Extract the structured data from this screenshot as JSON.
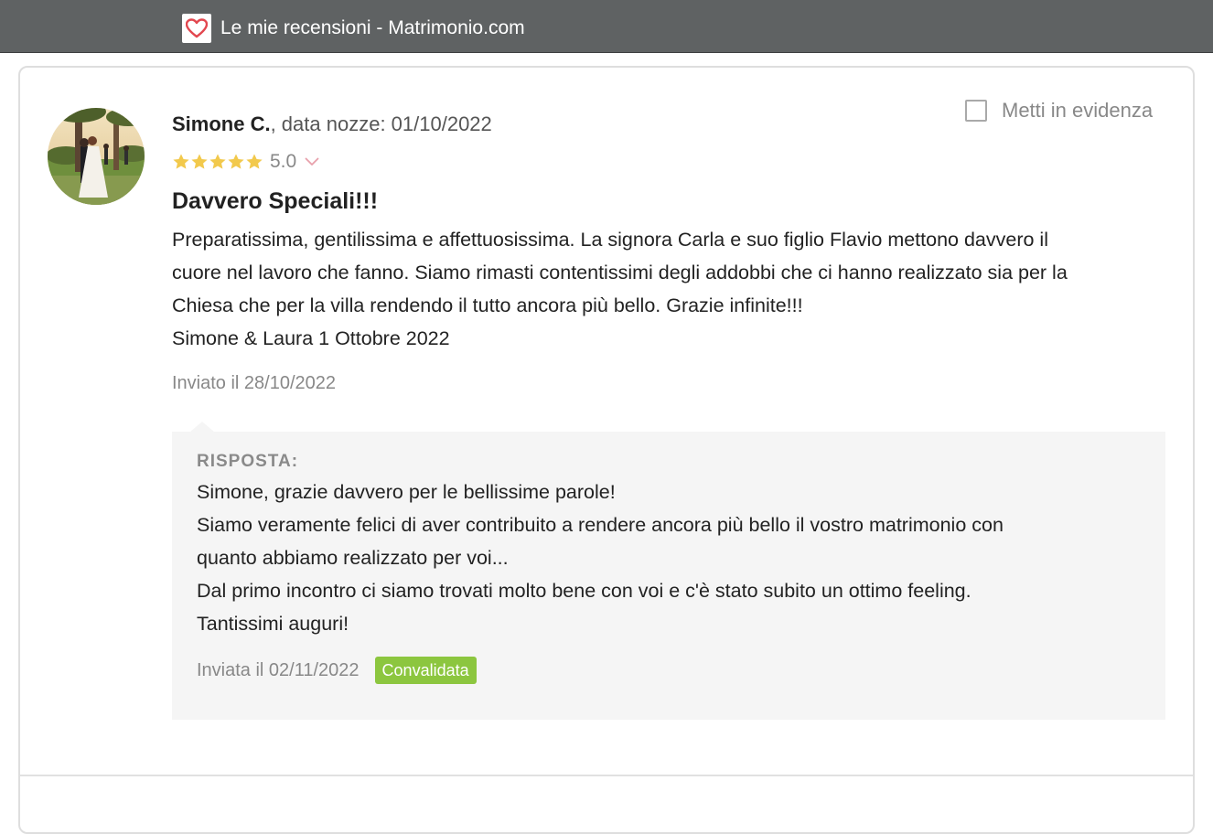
{
  "window": {
    "title": "Le mie recensioni - Matrimonio.com",
    "icon": "matrimonio-heart-icon"
  },
  "review": {
    "author_name": "Simone C.",
    "wedding_date_text": ", data nozze: 01/10/2022",
    "rating_stars": 5,
    "rating_max": 5,
    "rating_value": "5.0",
    "title": "Davvero Speciali!!!",
    "body_lines": [
      "Preparatissima, gentilissima e affettuosissima. La signora Carla e suo figlio Flavio mettono davvero il",
      "cuore nel lavoro che fanno. Siamo rimasti contentissimi degli addobbi che ci hanno realizzato sia per la",
      "Chiesa che per la villa rendendo il tutto ancora più bello. Grazie infinite!!!",
      "Simone & Laura 1 Ottobre 2022"
    ],
    "sent_date": "Inviato il 28/10/2022",
    "highlight_label": "Metti in evidenza",
    "highlight_checked": false
  },
  "reply": {
    "heading": "RISPOSTA:",
    "body_lines": [
      "Simone, grazie davvero per le bellissime parole!",
      "Siamo veramente felici di aver contribuito a rendere ancora più bello il vostro matrimonio con",
      "quanto abbiamo realizzato per voi...",
      "Dal primo incontro ci siamo trovati molto bene con voi e c'è stato subito un ottimo feeling.",
      "Tantissimi auguri!"
    ],
    "sent_date": "Inviata il 02/11/2022",
    "status_badge": "Convalidata"
  },
  "colors": {
    "titlebar": "#5f6263",
    "star": "#f2c94c",
    "chevron": "#e8a0ab",
    "badge": "#8cc63f",
    "favicon_heart": "#e2474f"
  }
}
